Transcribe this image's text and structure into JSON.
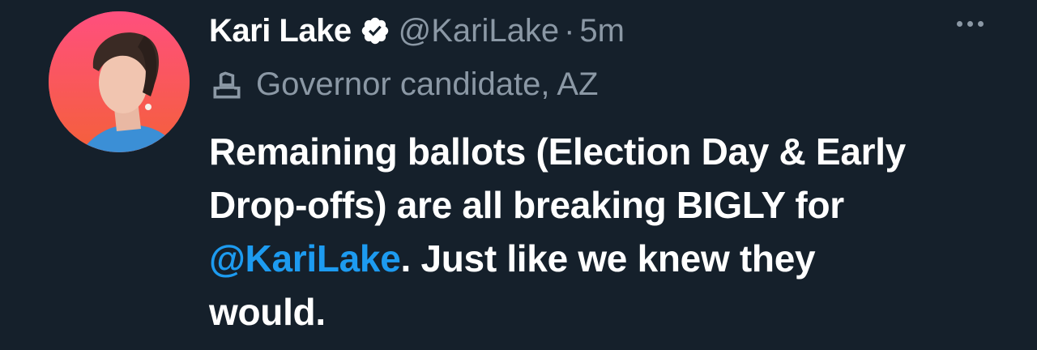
{
  "tweet": {
    "display_name": "Kari Lake",
    "handle": "@KariLake",
    "separator": "·",
    "time": "5m",
    "label": "Governor candidate, AZ",
    "text_line1": "Remaining ballots (Election Day & Early",
    "text_line2": "Drop-offs) are all breaking BIGLY for",
    "mention": "@KariLake",
    "text_line3_rest": ". Just like we knew they",
    "text_line4": "would."
  },
  "icons": {
    "verified": "verified-badge-icon",
    "label": "ballot-box-icon",
    "more": "more-options-icon"
  },
  "colors": {
    "background": "#15202b",
    "text": "#ffffff",
    "secondary": "#8b98a5",
    "link": "#1d9bf0"
  }
}
